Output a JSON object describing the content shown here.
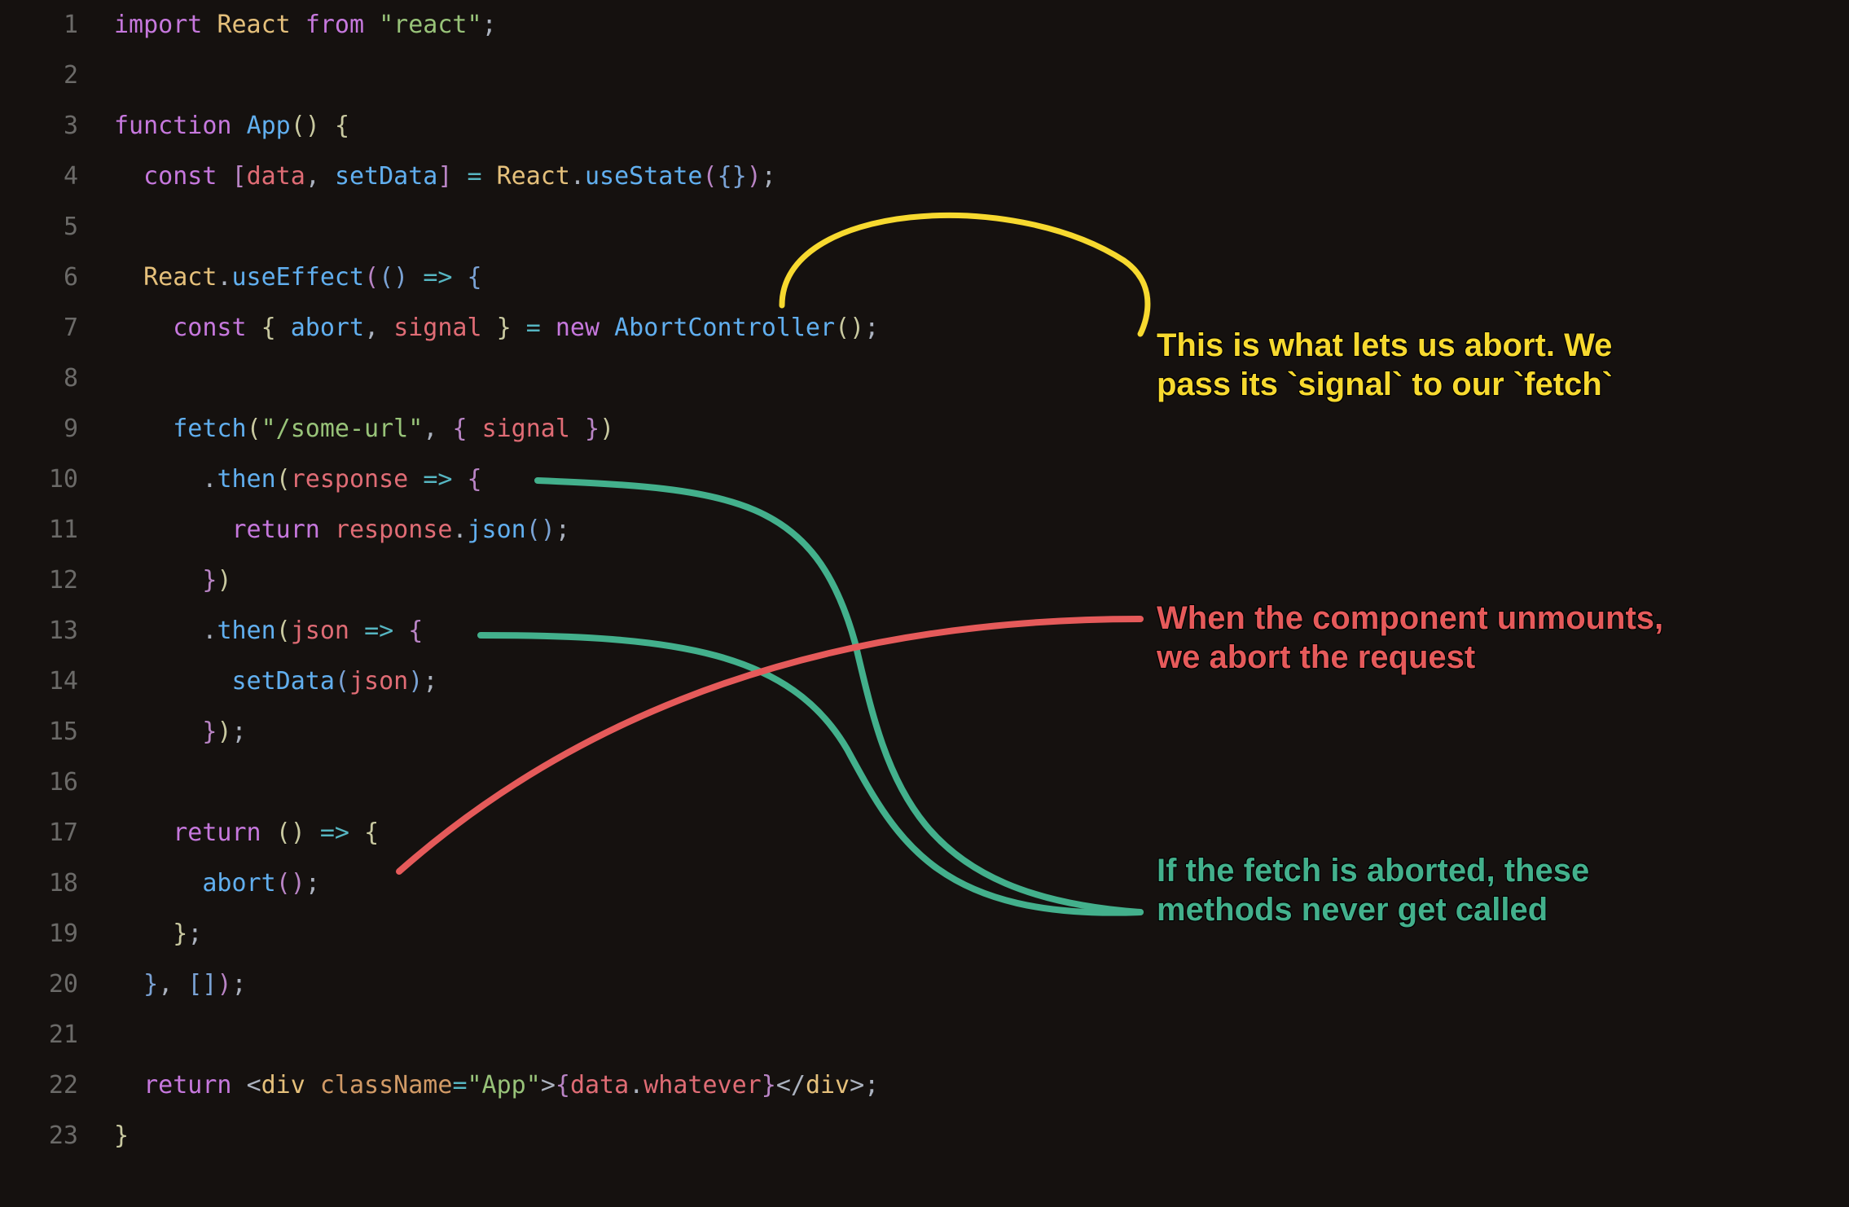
{
  "colors": {
    "background": "#15110f",
    "gutter": "#6b6a68",
    "keyword": "#c678dd",
    "type": "#e5c07b",
    "string": "#98c379",
    "func": "#61afef",
    "param": "#e06c75",
    "operator": "#56b6c2",
    "default": "#abb2bf",
    "attr": "#d19a66",
    "ann_yellow": "#f7d92f",
    "ann_red": "#e55a5a",
    "ann_green": "#43b08c"
  },
  "lines": [
    {
      "n": "1",
      "tokens": [
        [
          "kw",
          "import"
        ],
        [
          "prop",
          " "
        ],
        [
          "def",
          "React"
        ],
        [
          "prop",
          " "
        ],
        [
          "kw",
          "from"
        ],
        [
          "prop",
          " "
        ],
        [
          "str",
          "\"react\""
        ],
        [
          "punct",
          ";"
        ]
      ]
    },
    {
      "n": "2",
      "tokens": []
    },
    {
      "n": "3",
      "tokens": [
        [
          "kw",
          "function"
        ],
        [
          "prop",
          " "
        ],
        [
          "fn",
          "App"
        ],
        [
          "paren",
          "()"
        ],
        [
          "prop",
          " "
        ],
        [
          "paren",
          "{"
        ]
      ]
    },
    {
      "n": "4",
      "tokens": [
        [
          "prop",
          "  "
        ],
        [
          "kw",
          "const"
        ],
        [
          "prop",
          " "
        ],
        [
          "paren2",
          "["
        ],
        [
          "param",
          "data"
        ],
        [
          "punct",
          ", "
        ],
        [
          "fn",
          "setData"
        ],
        [
          "paren2",
          "]"
        ],
        [
          "prop",
          " "
        ],
        [
          "op",
          "="
        ],
        [
          "prop",
          " "
        ],
        [
          "def",
          "React"
        ],
        [
          "punct",
          "."
        ],
        [
          "fn",
          "useState"
        ],
        [
          "paren2",
          "("
        ],
        [
          "paren3",
          "{}"
        ],
        [
          "paren2",
          ")"
        ],
        [
          "punct",
          ";"
        ]
      ]
    },
    {
      "n": "5",
      "tokens": []
    },
    {
      "n": "6",
      "tokens": [
        [
          "prop",
          "  "
        ],
        [
          "def",
          "React"
        ],
        [
          "punct",
          "."
        ],
        [
          "fn",
          "useEffect"
        ],
        [
          "paren2",
          "("
        ],
        [
          "paren3",
          "()"
        ],
        [
          "prop",
          " "
        ],
        [
          "op",
          "=>"
        ],
        [
          "prop",
          " "
        ],
        [
          "paren3",
          "{"
        ]
      ]
    },
    {
      "n": "7",
      "tokens": [
        [
          "prop",
          "    "
        ],
        [
          "kw",
          "const"
        ],
        [
          "prop",
          " "
        ],
        [
          "paren",
          "{"
        ],
        [
          "prop",
          " "
        ],
        [
          "fn",
          "abort"
        ],
        [
          "punct",
          ", "
        ],
        [
          "param",
          "signal"
        ],
        [
          "prop",
          " "
        ],
        [
          "paren",
          "}"
        ],
        [
          "prop",
          " "
        ],
        [
          "op",
          "="
        ],
        [
          "prop",
          " "
        ],
        [
          "kw",
          "new"
        ],
        [
          "prop",
          " "
        ],
        [
          "fn",
          "AbortController"
        ],
        [
          "paren",
          "()"
        ],
        [
          "punct",
          ";"
        ]
      ]
    },
    {
      "n": "8",
      "tokens": []
    },
    {
      "n": "9",
      "tokens": [
        [
          "prop",
          "    "
        ],
        [
          "fn",
          "fetch"
        ],
        [
          "paren",
          "("
        ],
        [
          "str",
          "\"/some-url\""
        ],
        [
          "punct",
          ", "
        ],
        [
          "paren2",
          "{"
        ],
        [
          "prop",
          " "
        ],
        [
          "param",
          "signal"
        ],
        [
          "prop",
          " "
        ],
        [
          "paren2",
          "}"
        ],
        [
          "paren",
          ")"
        ]
      ]
    },
    {
      "n": "10",
      "tokens": [
        [
          "prop",
          "      "
        ],
        [
          "punct",
          "."
        ],
        [
          "fn",
          "then"
        ],
        [
          "paren",
          "("
        ],
        [
          "param",
          "response"
        ],
        [
          "prop",
          " "
        ],
        [
          "op",
          "=>"
        ],
        [
          "prop",
          " "
        ],
        [
          "paren2",
          "{"
        ]
      ]
    },
    {
      "n": "11",
      "tokens": [
        [
          "prop",
          "        "
        ],
        [
          "kw",
          "return"
        ],
        [
          "prop",
          " "
        ],
        [
          "param",
          "response"
        ],
        [
          "punct",
          "."
        ],
        [
          "fn",
          "json"
        ],
        [
          "paren3",
          "()"
        ],
        [
          "punct",
          ";"
        ]
      ]
    },
    {
      "n": "12",
      "tokens": [
        [
          "prop",
          "      "
        ],
        [
          "paren2",
          "}"
        ],
        [
          "paren",
          ")"
        ]
      ]
    },
    {
      "n": "13",
      "tokens": [
        [
          "prop",
          "      "
        ],
        [
          "punct",
          "."
        ],
        [
          "fn",
          "then"
        ],
        [
          "paren",
          "("
        ],
        [
          "param",
          "json"
        ],
        [
          "prop",
          " "
        ],
        [
          "op",
          "=>"
        ],
        [
          "prop",
          " "
        ],
        [
          "paren2",
          "{"
        ]
      ]
    },
    {
      "n": "14",
      "tokens": [
        [
          "prop",
          "        "
        ],
        [
          "fn",
          "setData"
        ],
        [
          "paren3",
          "("
        ],
        [
          "param",
          "json"
        ],
        [
          "paren3",
          ")"
        ],
        [
          "punct",
          ";"
        ]
      ]
    },
    {
      "n": "15",
      "tokens": [
        [
          "prop",
          "      "
        ],
        [
          "paren2",
          "}"
        ],
        [
          "paren",
          ")"
        ],
        [
          "punct",
          ";"
        ]
      ]
    },
    {
      "n": "16",
      "tokens": []
    },
    {
      "n": "17",
      "tokens": [
        [
          "prop",
          "    "
        ],
        [
          "kw",
          "return"
        ],
        [
          "prop",
          " "
        ],
        [
          "paren",
          "()"
        ],
        [
          "prop",
          " "
        ],
        [
          "op",
          "=>"
        ],
        [
          "prop",
          " "
        ],
        [
          "paren",
          "{"
        ]
      ]
    },
    {
      "n": "18",
      "tokens": [
        [
          "prop",
          "      "
        ],
        [
          "fn",
          "abort"
        ],
        [
          "paren2",
          "()"
        ],
        [
          "punct",
          ";"
        ]
      ]
    },
    {
      "n": "19",
      "tokens": [
        [
          "prop",
          "    "
        ],
        [
          "paren",
          "}"
        ],
        [
          "punct",
          ";"
        ]
      ]
    },
    {
      "n": "20",
      "tokens": [
        [
          "prop",
          "  "
        ],
        [
          "paren3",
          "}"
        ],
        [
          "punct",
          ", "
        ],
        [
          "paren3",
          "["
        ],
        [
          "paren3",
          "]"
        ],
        [
          "paren2",
          ")"
        ],
        [
          "punct",
          ";"
        ]
      ]
    },
    {
      "n": "21",
      "tokens": []
    },
    {
      "n": "22",
      "tokens": [
        [
          "prop",
          "  "
        ],
        [
          "kw",
          "return"
        ],
        [
          "prop",
          " "
        ],
        [
          "punct",
          "<"
        ],
        [
          "id",
          "div"
        ],
        [
          "prop",
          " "
        ],
        [
          "attr",
          "className"
        ],
        [
          "op",
          "="
        ],
        [
          "str",
          "\"App\""
        ],
        [
          "punct",
          ">"
        ],
        [
          "paren2",
          "{"
        ],
        [
          "param",
          "data"
        ],
        [
          "punct",
          "."
        ],
        [
          "param",
          "whatever"
        ],
        [
          "paren2",
          "}"
        ],
        [
          "punct",
          "</"
        ],
        [
          "id",
          "div"
        ],
        [
          "punct",
          ">;"
        ]
      ]
    },
    {
      "n": "23",
      "tokens": [
        [
          "paren",
          "}"
        ]
      ]
    }
  ],
  "annotations": {
    "yellow": "This is what lets us abort. We pass its `signal` to our `fetch`",
    "red": "When the component unmounts, we abort the request",
    "green": "If the fetch is aborted, these methods never get called"
  }
}
